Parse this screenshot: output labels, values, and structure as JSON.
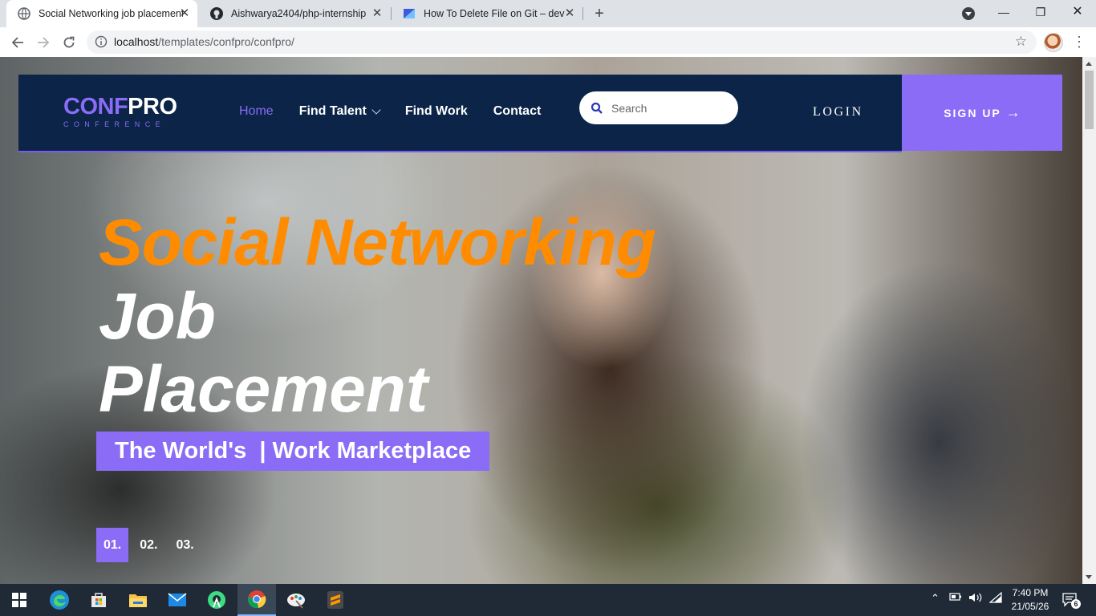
{
  "browser": {
    "tabs": [
      {
        "title": "Social Networking job placement",
        "active": true
      },
      {
        "title": "Aishwarya2404/php-internship",
        "active": false
      },
      {
        "title": "How To Delete File on Git – devco",
        "active": false
      }
    ],
    "url_host": "localhost",
    "url_path": "/templates/confpro/confpro/"
  },
  "site": {
    "logo": {
      "part1": "CONF",
      "part2": "PRO",
      "tagline": "CONFERENCE"
    },
    "nav": [
      {
        "label": "Home",
        "active": true
      },
      {
        "label": "Find Talent",
        "has_dropdown": true
      },
      {
        "label": "Find Work"
      },
      {
        "label": "Contact"
      }
    ],
    "search_placeholder": "Search",
    "login_label": "LOGIN",
    "signup_label": "SIGN UP",
    "colors": {
      "nav_bg": "#0b2447",
      "accent": "#8a6cf7",
      "headline_orange": "#ff8c00"
    }
  },
  "hero": {
    "line1": "Social Networking",
    "line2": "Job",
    "line3": "Placement",
    "tagline": "The World's  | Work Marketplace",
    "slides": [
      {
        "label": "01.",
        "active": true
      },
      {
        "label": "02.",
        "active": false
      },
      {
        "label": "03.",
        "active": false
      }
    ]
  },
  "taskbar": {
    "apps": [
      "start-icon",
      "edge-icon",
      "store-icon",
      "file-explorer-icon",
      "mail-icon",
      "android-studio-icon",
      "chrome-icon",
      "paint-icon",
      "sublime-icon"
    ],
    "time": "7:40 PM",
    "date": "21/05/26",
    "notifications": "6"
  }
}
